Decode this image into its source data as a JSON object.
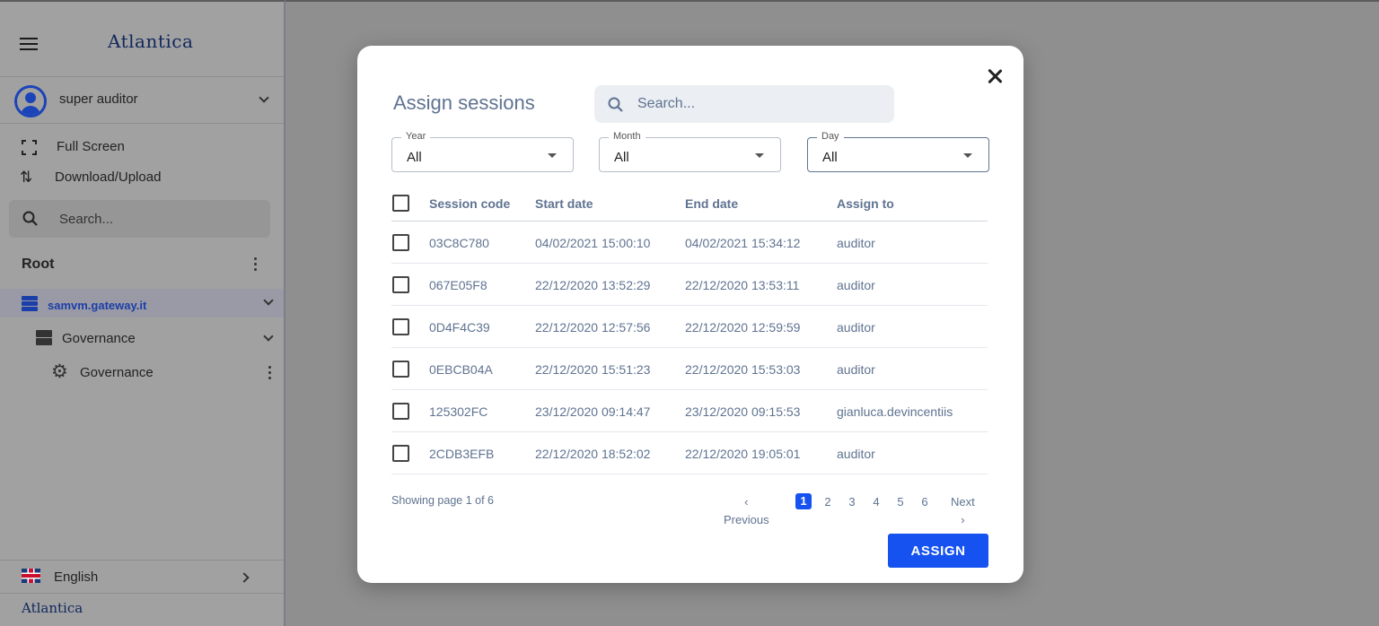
{
  "sidebar": {
    "logo": "Atlantica",
    "user": "super auditor",
    "full_screen": "Full Screen",
    "download_upload": "Download/Upload",
    "search_placeholder": "Search...",
    "root": "Root",
    "tree": {
      "gateway": "samvm.gateway.it",
      "governance_group": "Governance",
      "governance_item": "Governance"
    },
    "language": "English",
    "footer_logo": "Atlantica"
  },
  "modal": {
    "title": "Assign sessions",
    "search_placeholder": "Search...",
    "filters": {
      "year": {
        "label": "Year",
        "value": "All"
      },
      "month": {
        "label": "Month",
        "value": "All"
      },
      "day": {
        "label": "Day",
        "value": "All"
      }
    },
    "table": {
      "headers": [
        "Session code",
        "Start date",
        "End date",
        "Assign to"
      ],
      "rows": [
        [
          "03C8C780",
          "04/02/2021 15:00:10",
          "04/02/2021 15:34:12",
          "auditor"
        ],
        [
          "067E05F8",
          "22/12/2020 13:52:29",
          "22/12/2020 13:53:11",
          "auditor"
        ],
        [
          "0D4F4C39",
          "22/12/2020 12:57:56",
          "22/12/2020 12:59:59",
          "auditor"
        ],
        [
          "0EBCB04A",
          "22/12/2020 15:51:23",
          "22/12/2020 15:53:03",
          "auditor"
        ],
        [
          "125302FC",
          "23/12/2020 09:14:47",
          "23/12/2020 09:15:53",
          "gianluca.devincentiis"
        ],
        [
          "2CDB3EFB",
          "22/12/2020 18:52:02",
          "22/12/2020 19:05:01",
          "auditor"
        ]
      ]
    },
    "showing": "Showing page 1 of 6",
    "pagination": {
      "previous": "Previous",
      "next": "Next",
      "pages": [
        "1",
        "2",
        "3",
        "4",
        "5",
        "6"
      ],
      "current": "1"
    },
    "assign_button": "ASSIGN"
  },
  "colors": {
    "accent": "#1652f0",
    "muted_text": "#5f7391",
    "overlay": "#8f8f8f"
  }
}
